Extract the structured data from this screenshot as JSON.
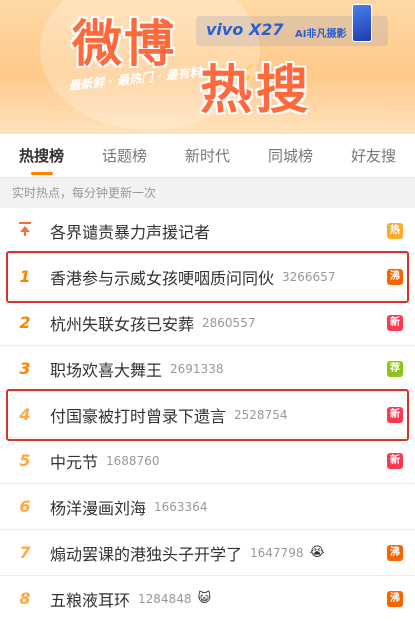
{
  "banner": {
    "title_part1": "微博",
    "title_part2": "热搜",
    "slogan": "最新鲜 · 最热门 · 最有料",
    "ad_brand": "vivo X27",
    "ad_sub": "AI非凡摄影"
  },
  "tabs": [
    {
      "label": "热搜榜",
      "active": true
    },
    {
      "label": "话题榜"
    },
    {
      "label": "新时代"
    },
    {
      "label": "同城榜"
    },
    {
      "label": "好友搜"
    }
  ],
  "subhead": "实时热点，每分钟更新一次",
  "items": [
    {
      "rank": "",
      "topic": "各界谴责暴力声援记者",
      "count": "",
      "badge": "热",
      "badge_color": "#ffab2d"
    },
    {
      "rank": "1",
      "topic": "香港参与示威女孩哽咽质问同伙",
      "count": "3266657",
      "badge": "沸",
      "badge_color": "#f86400"
    },
    {
      "rank": "2",
      "topic": "杭州失联女孩已安葬",
      "count": "2860557",
      "badge": "新",
      "badge_color": "#ff3852"
    },
    {
      "rank": "3",
      "topic": "职场欢喜大舞王",
      "count": "2691338",
      "badge": "荐",
      "badge_color": "#8fc21e"
    },
    {
      "rank": "4",
      "topic": "付国豪被打时曾录下遗言",
      "count": "2528754",
      "badge": "新",
      "badge_color": "#ff3852"
    },
    {
      "rank": "5",
      "topic": "中元节",
      "count": "1688760",
      "badge": "新",
      "badge_color": "#ff3852"
    },
    {
      "rank": "6",
      "topic": "杨洋漫画刘海",
      "count": "1663364",
      "badge": "",
      "badge_color": ""
    },
    {
      "rank": "7",
      "topic": "煽动罢课的港独头子开学了",
      "count": "1647798",
      "emoji": "😭",
      "badge": "沸",
      "badge_color": "#f86400"
    },
    {
      "rank": "8",
      "topic": "五粮液耳环",
      "count": "1284848",
      "emoji": "😺",
      "badge": "沸",
      "badge_color": "#f86400"
    }
  ]
}
